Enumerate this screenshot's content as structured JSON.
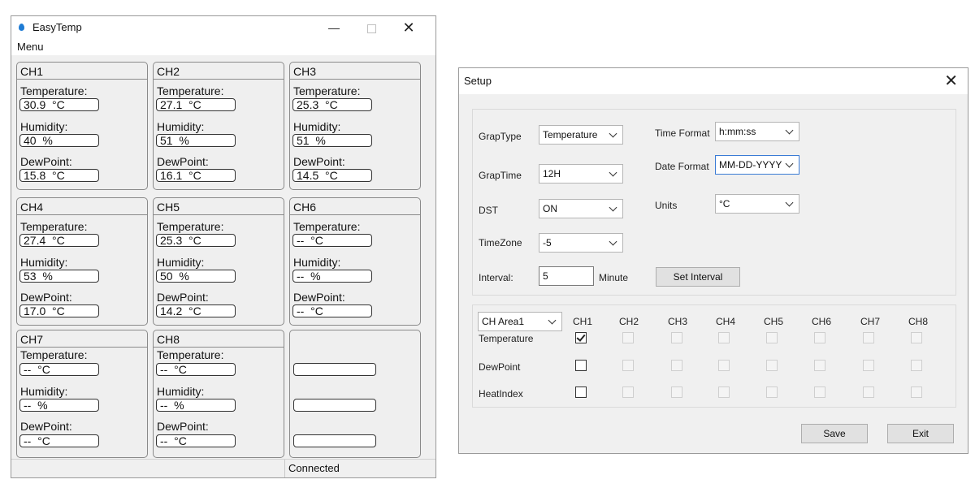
{
  "main_window": {
    "title": "EasyTemp",
    "minimize_glyph": "—",
    "close_glyph": "✕",
    "menu": "Menu",
    "field_labels": {
      "temperature": "Temperature:",
      "humidity": "Humidity:",
      "dewpoint": "DewPoint:"
    },
    "channels": [
      {
        "name": "CH1",
        "temperature": "30.9  °C",
        "humidity": "40  %",
        "dewpoint": "15.8  °C"
      },
      {
        "name": "CH2",
        "temperature": "27.1  °C",
        "humidity": "51  %",
        "dewpoint": "16.1  °C"
      },
      {
        "name": "CH3",
        "temperature": "25.3  °C",
        "humidity": "51  %",
        "dewpoint": "14.5  °C"
      },
      {
        "name": "CH4",
        "temperature": "27.4  °C",
        "humidity": "53  %",
        "dewpoint": "17.0  °C"
      },
      {
        "name": "CH5",
        "temperature": "25.3  °C",
        "humidity": "50  %",
        "dewpoint": "14.2  °C"
      },
      {
        "name": "CH6",
        "temperature": "--  °C",
        "humidity": "--  %",
        "dewpoint": "--  °C"
      },
      {
        "name": "CH7",
        "temperature": "--  °C",
        "humidity": "--  %",
        "dewpoint": "--  °C"
      },
      {
        "name": "CH8",
        "temperature": "--  °C",
        "humidity": "--  %",
        "dewpoint": "--  °C"
      }
    ],
    "status": "Connected"
  },
  "setup_window": {
    "title": "Setup",
    "close_glyph": "✕",
    "graph_type": {
      "label": "GrapType",
      "value": "Temperature"
    },
    "graph_time": {
      "label": "GrapTime",
      "value": "12H"
    },
    "dst": {
      "label": "DST",
      "value": "ON"
    },
    "timezone": {
      "label": "TimeZone",
      "value": "-5"
    },
    "interval": {
      "label": "Interval:",
      "value": "5",
      "unit": "Minute",
      "button": "Set Interval"
    },
    "time_format": {
      "label": "Time Format",
      "value": "h:mm:ss"
    },
    "date_format": {
      "label": "Date Format",
      "value": "MM-DD-YYYY"
    },
    "units": {
      "label": "Units",
      "value": "°C"
    },
    "ch_area": {
      "value": "CH Area1"
    },
    "channel_headers": [
      "CH1",
      "CH2",
      "CH3",
      "CH4",
      "CH5",
      "CH6",
      "CH7",
      "CH8"
    ],
    "rows": [
      {
        "label": "Temperature",
        "ch1_checked": true
      },
      {
        "label": "DewPoint",
        "ch1_checked": false
      },
      {
        "label": "HeatIndex",
        "ch1_checked": false
      }
    ],
    "save_button": "Save",
    "exit_button": "Exit"
  }
}
